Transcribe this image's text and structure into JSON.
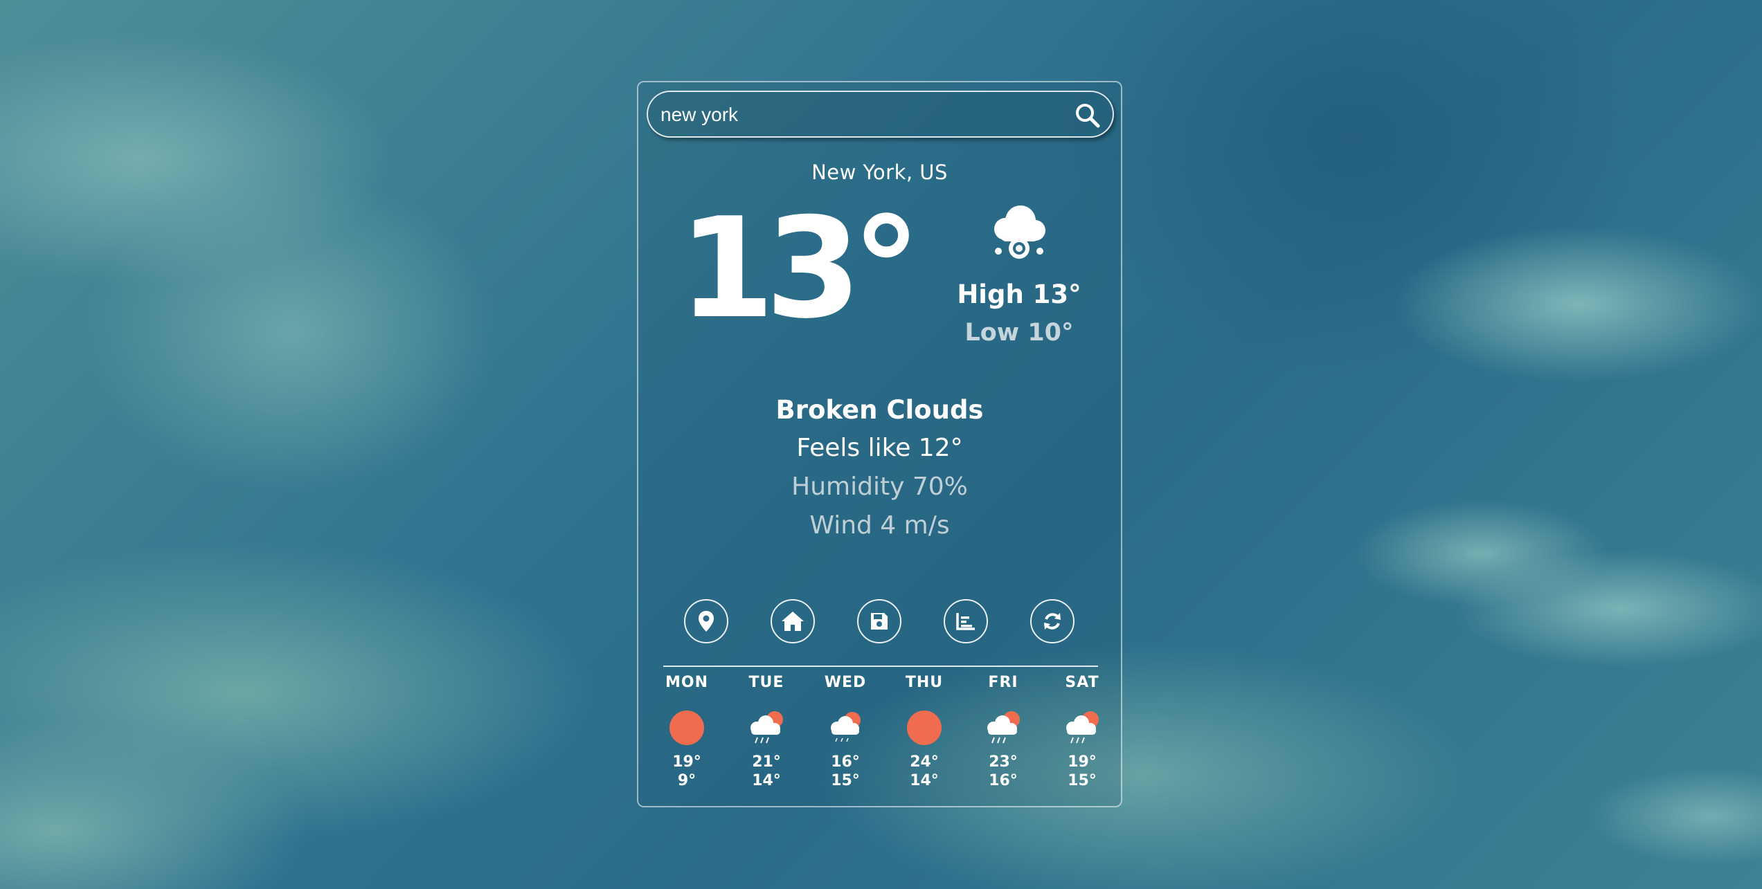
{
  "search": {
    "value": "new york",
    "icon": "search-icon"
  },
  "location": "New York, US",
  "current": {
    "temp": "13°",
    "icon": "snow-cloud-icon",
    "high": "High 13°",
    "low": "Low 10°",
    "description": "Broken Clouds",
    "feels_like": "Feels like 12°",
    "humidity": "Humidity 70%",
    "wind": "Wind 4 m/s"
  },
  "actions": [
    {
      "name": "location-button",
      "icon": "map-pin-icon"
    },
    {
      "name": "home-button",
      "icon": "home-icon"
    },
    {
      "name": "save-button",
      "icon": "save-icon"
    },
    {
      "name": "chart-button",
      "icon": "bar-chart-icon"
    },
    {
      "name": "refresh-button",
      "icon": "refresh-icon"
    }
  ],
  "forecast": [
    {
      "day": "MON",
      "icon": "sun-icon",
      "high": "19°",
      "low": "9°"
    },
    {
      "day": "TUE",
      "icon": "rain-cloud-sun-icon",
      "high": "21°",
      "low": "14°"
    },
    {
      "day": "WED",
      "icon": "cloud-sun-icon",
      "high": "16°",
      "low": "15°"
    },
    {
      "day": "THU",
      "icon": "sun-icon",
      "high": "24°",
      "low": "14°"
    },
    {
      "day": "FRI",
      "icon": "rain-cloud-sun-icon",
      "high": "23°",
      "low": "16°"
    },
    {
      "day": "SAT",
      "icon": "rain-cloud-sun-icon",
      "high": "19°",
      "low": "15°"
    }
  ],
  "colors": {
    "sun": "#f06c4e",
    "text": "#ffffff",
    "muted": "#c0cfd6"
  }
}
